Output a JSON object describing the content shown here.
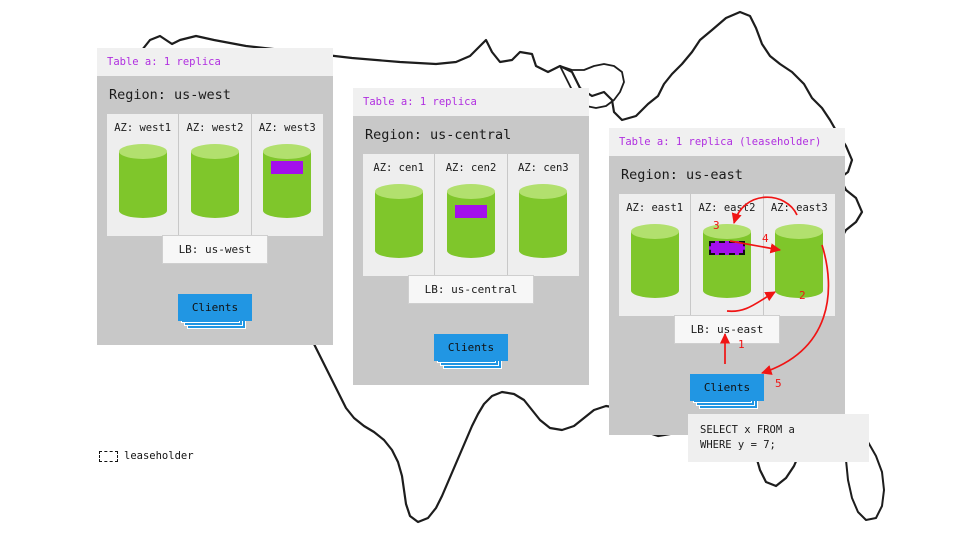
{
  "legend": {
    "swatch_icon": "dashed-rect-icon",
    "label": "leaseholder"
  },
  "regions": [
    {
      "id": "us-west",
      "header": "Table a: 1 replica",
      "title": "Region: us-west",
      "azs": [
        {
          "label": "AZ: west1",
          "replica": false,
          "leaseholder": false
        },
        {
          "label": "AZ: west2",
          "replica": false,
          "leaseholder": false
        },
        {
          "label": "AZ: west3",
          "replica": true,
          "leaseholder": false
        }
      ],
      "lb": "LB: us-west",
      "clients": "Clients"
    },
    {
      "id": "us-central",
      "header": "Table a: 1 replica",
      "title": "Region: us-central",
      "azs": [
        {
          "label": "AZ: cen1",
          "replica": false,
          "leaseholder": false
        },
        {
          "label": "AZ: cen2",
          "replica": true,
          "leaseholder": false
        },
        {
          "label": "AZ: cen3",
          "replica": false,
          "leaseholder": false
        }
      ],
      "lb": "LB: us-central",
      "clients": "Clients"
    },
    {
      "id": "us-east",
      "header": "Table a: 1 replica (leaseholder)",
      "title": "Region: us-east",
      "azs": [
        {
          "label": "AZ: east1",
          "replica": false,
          "leaseholder": false
        },
        {
          "label": "AZ: east2",
          "replica": true,
          "leaseholder": true
        },
        {
          "label": "AZ: east3",
          "replica": false,
          "leaseholder": false
        }
      ],
      "lb": "LB: us-east",
      "clients": "Clients"
    }
  ],
  "sql_query": "SELECT x FROM a\nWHERE y = 7;",
  "flow_steps": [
    {
      "n": "1",
      "from": "Clients",
      "to": "LB: us-east"
    },
    {
      "n": "2",
      "from": "LB: us-east",
      "to": "AZ: east3"
    },
    {
      "n": "3",
      "from": "AZ: east3",
      "to": "AZ: east2 leaseholder"
    },
    {
      "n": "4",
      "from": "AZ: east2 leaseholder",
      "to": "AZ: east3"
    },
    {
      "n": "5",
      "from": "AZ: east3",
      "to": "Clients"
    }
  ],
  "colors": {
    "replica_purple": "#a310ec",
    "cylinder_green": "#7fc62b",
    "cylinder_top_green": "#b2e06e",
    "clients_blue": "#2196e3",
    "arrow_red": "#f01414",
    "header_magenta": "#b02ee0",
    "region_gray": "#c8c8c8",
    "panel_gray": "#eeeeee"
  }
}
